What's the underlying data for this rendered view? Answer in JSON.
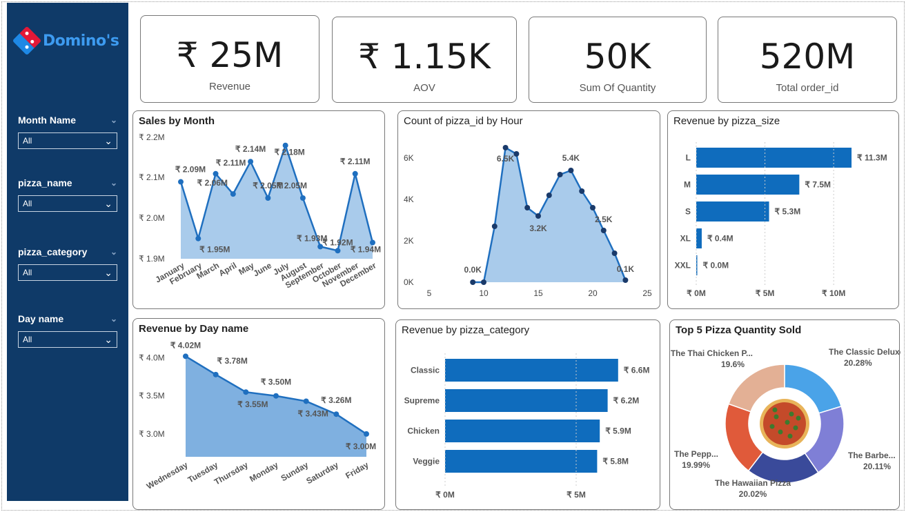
{
  "brand": {
    "name": "Domino's",
    "logo_colors": [
      "#e31837",
      "#1e88e5"
    ]
  },
  "colors": {
    "sidebar": "#0f3a68",
    "bar": "#0f6cbd",
    "area_fill": "#a9cbeb",
    "area_line": "#1f6fbf",
    "pie": [
      "#4aa3e8",
      "#7f7fd6",
      "#3a4a9a",
      "#e05a3a",
      "#e3b095"
    ]
  },
  "slicers": [
    {
      "title": "Month Name",
      "value": "All"
    },
    {
      "title": "pizza_name",
      "value": "All"
    },
    {
      "title": "pizza_category",
      "value": "All"
    },
    {
      "title": "Day name",
      "value": "All"
    }
  ],
  "kpis": [
    {
      "value": "₹ 25M",
      "label": "Revenue"
    },
    {
      "value": "₹ 1.15K",
      "label": "AOV"
    },
    {
      "value": "50K",
      "label": "Sum Of Quantity"
    },
    {
      "value": "520M",
      "label": "Total order_id"
    }
  ],
  "panels": {
    "sales_by_month": "Sales by Month",
    "pizza_by_hour": "Count of pizza_id by Hour",
    "revenue_by_size": "Revenue by pizza_size",
    "revenue_by_day": "Revenue by Day name",
    "revenue_by_category": "Revenue by pizza_category",
    "top5": "Top 5 Pizza Quantity Sold"
  },
  "chart_data": [
    {
      "id": "sales_by_month",
      "type": "area",
      "title": "Sales by Month",
      "categories": [
        "January",
        "February",
        "March",
        "April",
        "May",
        "June",
        "July",
        "August",
        "September",
        "October",
        "November",
        "December"
      ],
      "values": [
        2.09,
        1.95,
        2.11,
        2.06,
        2.14,
        2.05,
        2.18,
        2.05,
        1.93,
        1.92,
        2.11,
        1.94
      ],
      "data_labels": [
        "₹ 2.09M",
        "₹ 1.95M",
        "₹ 2.11M",
        "₹ 2.06M",
        "₹ 2.14M",
        "₹ 2.05M",
        "₹ 2.18M",
        "₹ 2.05M",
        "₹ 1.93M",
        "₹ 1.92M",
        "₹ 2.11M",
        "₹ 1.94M"
      ],
      "ylim": [
        1.9,
        2.2
      ],
      "yticks": [
        "₹ 2.2M",
        "₹ 2.1M",
        "₹ 2.0M",
        "₹ 1.9M"
      ],
      "grid": false
    },
    {
      "id": "pizza_by_hour",
      "type": "area",
      "title": "Count of pizza_id by Hour",
      "x": [
        9,
        10,
        11,
        12,
        13,
        14,
        15,
        16,
        17,
        18,
        19,
        20,
        21,
        22,
        23
      ],
      "y": [
        0.0,
        0.0,
        2.7,
        6.5,
        6.2,
        3.6,
        3.2,
        4.2,
        5.2,
        5.4,
        4.4,
        3.6,
        2.5,
        1.4,
        0.1
      ],
      "data_labels": {
        "9": "0.0K",
        "12": "6.5K",
        "15": "3.2K",
        "18": "5.4K",
        "21": "2.5K",
        "23": "0.1K"
      },
      "xlim": [
        5,
        25
      ],
      "xticks": [
        "5",
        "10",
        "15",
        "20",
        "25"
      ],
      "ylim": [
        0,
        7
      ],
      "yticks": [
        "6K",
        "4K",
        "2K",
        "0K"
      ],
      "grid": false
    },
    {
      "id": "revenue_by_size",
      "type": "bar",
      "title": "Revenue by pizza_size",
      "categories": [
        "L",
        "M",
        "S",
        "XL",
        "XXL"
      ],
      "values": [
        11.3,
        7.5,
        5.3,
        0.4,
        0.0
      ],
      "data_labels": [
        "₹ 11.3M",
        "₹ 7.5M",
        "₹ 5.3M",
        "₹ 0.4M",
        "₹ 0.0M"
      ],
      "xlim": [
        0,
        12
      ],
      "xticks": [
        "₹ 0M",
        "₹ 5M",
        "₹ 10M"
      ]
    },
    {
      "id": "revenue_by_day",
      "type": "area",
      "title": "Revenue by Day name",
      "categories": [
        "Wednesday",
        "Tuesday",
        "Thursday",
        "Monday",
        "Sunday",
        "Saturday",
        "Friday"
      ],
      "values": [
        4.02,
        3.78,
        3.55,
        3.5,
        3.43,
        3.26,
        3.0
      ],
      "data_labels": [
        "₹ 4.02M",
        "₹ 3.78M",
        "₹ 3.55M",
        "₹ 3.50M",
        "₹ 3.43M",
        "₹ 3.26M",
        "₹ 3.00M"
      ],
      "ylim": [
        2.7,
        4.15
      ],
      "yticks": [
        "₹ 4.0M",
        "₹ 3.5M",
        "₹ 3.0M"
      ]
    },
    {
      "id": "revenue_by_category",
      "type": "bar",
      "title": "Revenue by pizza_category",
      "categories": [
        "Classic",
        "Supreme",
        "Chicken",
        "Veggie"
      ],
      "values": [
        6.6,
        6.2,
        5.9,
        5.8
      ],
      "data_labels": [
        "₹ 6.6M",
        "₹ 6.2M",
        "₹ 5.9M",
        "₹ 5.8M"
      ],
      "xlim": [
        0,
        8
      ],
      "xticks": [
        "₹ 0M",
        "₹ 5M"
      ]
    },
    {
      "id": "top5",
      "type": "pie",
      "title": "Top 5 Pizza Quantity Sold",
      "labels": [
        "The Classic Deluxe...",
        "The Barbe...",
        "The Hawaiian Pizza",
        "The Pepp...",
        "The Thai Chicken P..."
      ],
      "values": [
        20.28,
        20.11,
        20.02,
        19.99,
        19.6
      ],
      "pct_labels": [
        "20.28%",
        "20.11%",
        "20.02%",
        "19.99%",
        "19.6%"
      ]
    }
  ]
}
